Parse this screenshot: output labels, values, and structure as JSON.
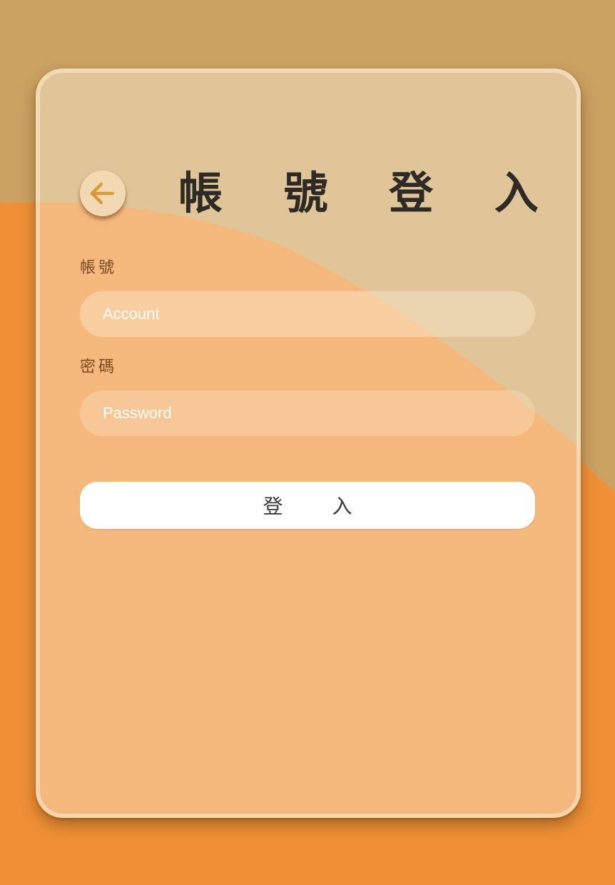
{
  "page": {
    "title": "帳 號 登 入"
  },
  "form": {
    "account_label": "帳號",
    "account_placeholder": "Account",
    "account_value": "",
    "password_label": "密碼",
    "password_placeholder": "Password",
    "password_value": "",
    "login_button_label": "登 入"
  },
  "icons": {
    "back": "arrow-left-icon"
  },
  "colors": {
    "background_tan": "#cba262",
    "background_orange": "#ef9037",
    "card_tan": "#dfc597",
    "card_orange": "#f4b87c",
    "accent_arrow": "#d99a3e",
    "title_text": "#2e2a25",
    "button_bg": "#ffffff"
  }
}
